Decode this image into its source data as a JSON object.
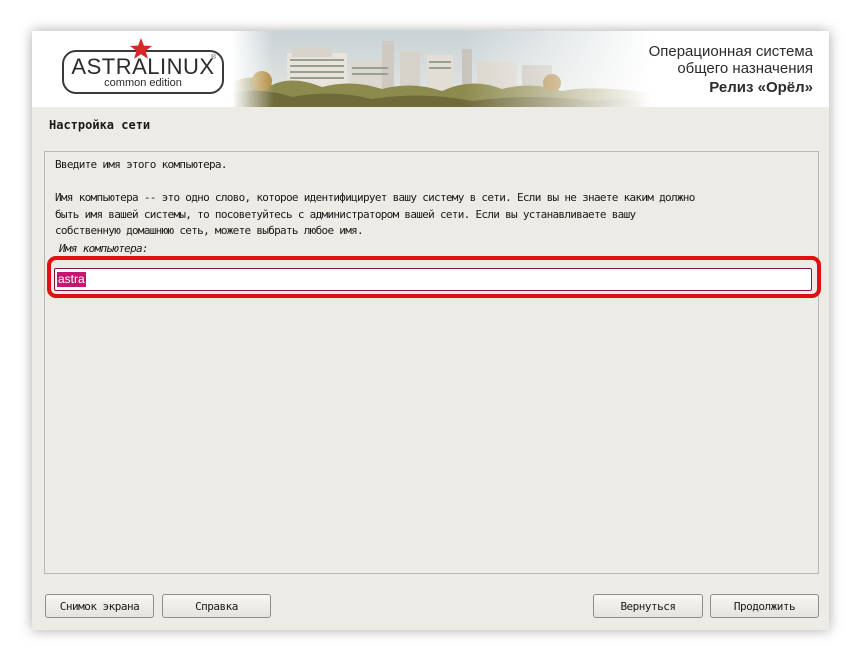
{
  "header": {
    "logo_text": "ASTRALINUX",
    "logo_subtext": "common edition",
    "logo_reg_mark": "®",
    "title_line1": "Операционная система",
    "title_line2": "общего назначения",
    "release": "Релиз «Орёл»"
  },
  "page": {
    "title": "Настройка сети"
  },
  "content": {
    "prompt": "Введите имя этого компьютера.",
    "description_line1": "Имя компьютера -- это одно слово, которое идентифицирует вашу систему в сети. Если вы не знаете каким должно",
    "description_line2": "быть имя вашей системы, то посоветуйтесь с администратором вашей сети. Если вы устанавливаете вашу",
    "description_line3": "собственную домашнюю сеть, можете выбрать любое имя.",
    "field_label": "Имя компьютера:",
    "hostname_value": "astra"
  },
  "buttons": {
    "screenshot": "Снимок экрана",
    "help": "Справка",
    "back": "Вернуться",
    "continue": "Продолжить"
  },
  "colors": {
    "window_bg": "#ecebe6",
    "highlight_ring": "#e01010",
    "selection": "#c21870",
    "logo_star": "#d62828"
  },
  "icons": [
    "red-star-icon"
  ]
}
